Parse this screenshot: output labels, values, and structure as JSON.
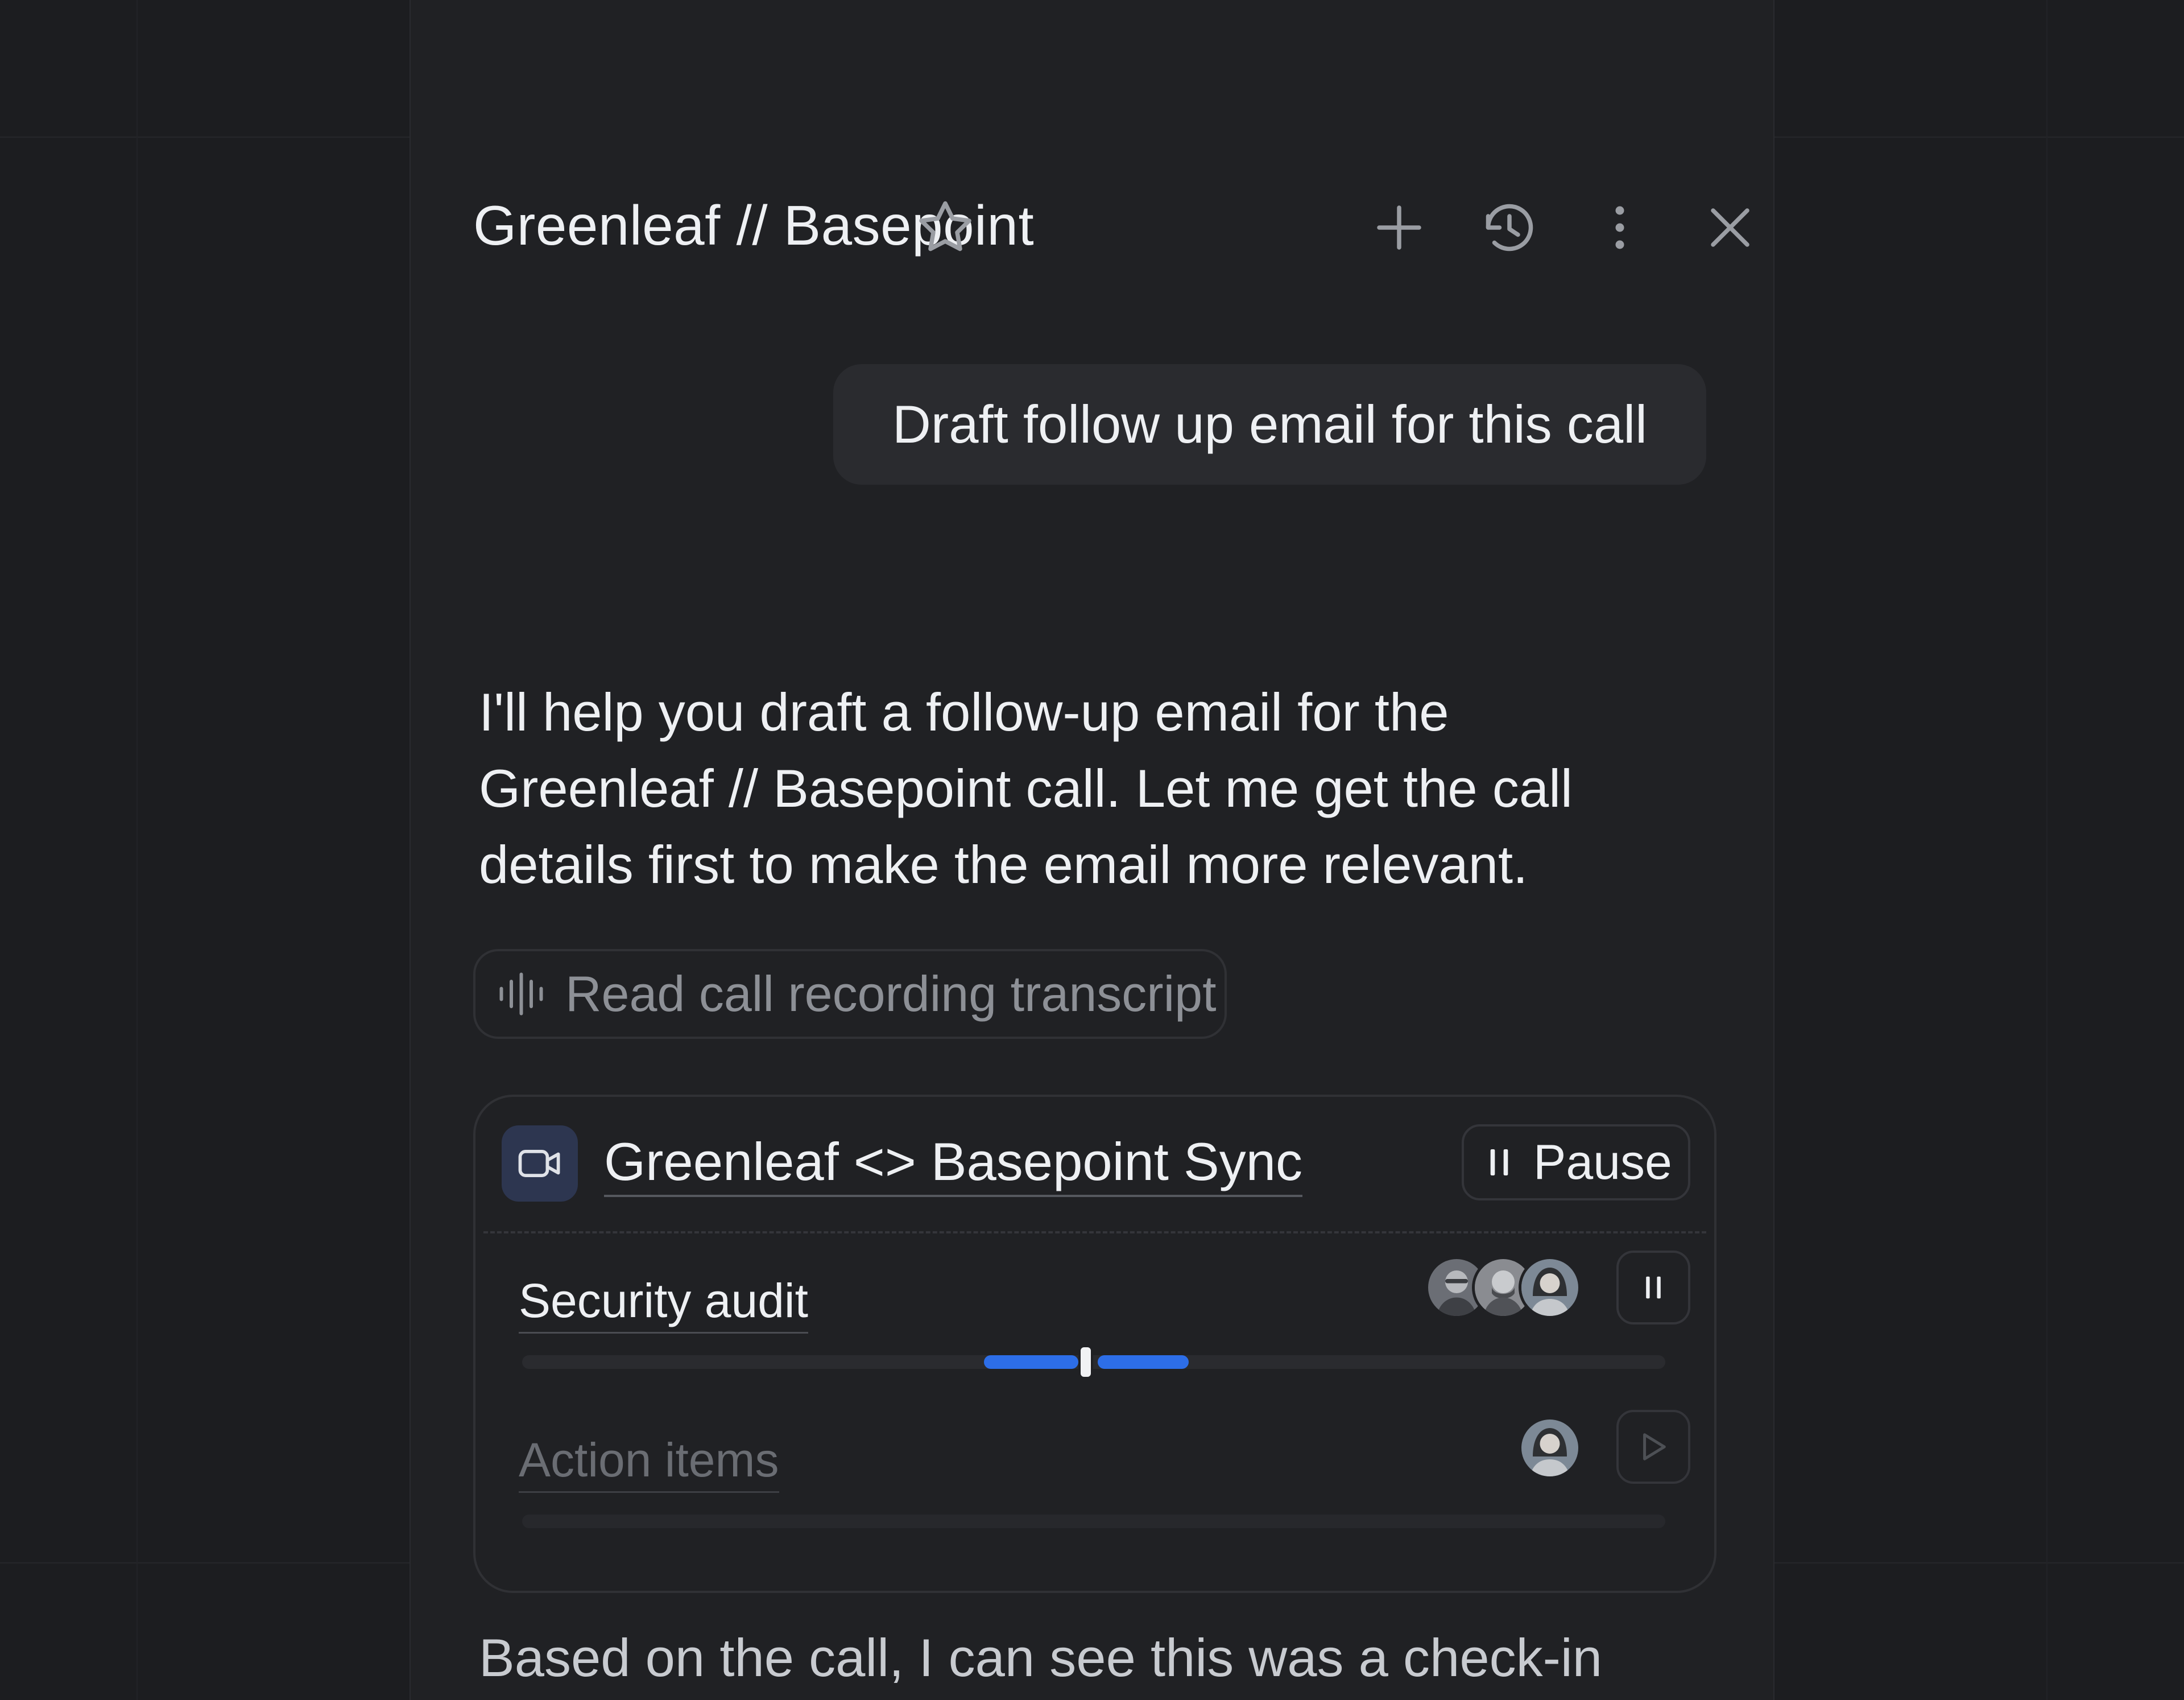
{
  "header": {
    "title": "Greenleaf // Basepoint",
    "icons": [
      "star-icon",
      "plus-icon",
      "history-icon",
      "more-vertical-icon",
      "close-icon"
    ]
  },
  "user_message": "Draft follow up email for this call",
  "assistant": {
    "lines": [
      "I'll help you draft a follow-up email for the",
      "Greenleaf // Basepoint call. Let me get the call",
      "details first to make the email more relevant."
    ]
  },
  "tool_chip": {
    "label": "Read call recording transcript",
    "icon": "waveform-icon"
  },
  "recording": {
    "title": "Greenleaf <> Basepoint Sync",
    "pause_label": "Pause",
    "segments": [
      {
        "label": "Security audit",
        "state": "playing",
        "progress": 0.5,
        "participants": 3
      },
      {
        "label": "Action items",
        "state": "paused",
        "progress": 0,
        "participants": 1
      }
    ]
  },
  "continuation_text": "Based on the call, I can see this was a check-in",
  "colors": {
    "background": "#1c1d20",
    "panel": "#202124",
    "bubble": "#2a2b2f",
    "accent_blue": "#2d6ee8",
    "muted_text": "#8d9096"
  }
}
